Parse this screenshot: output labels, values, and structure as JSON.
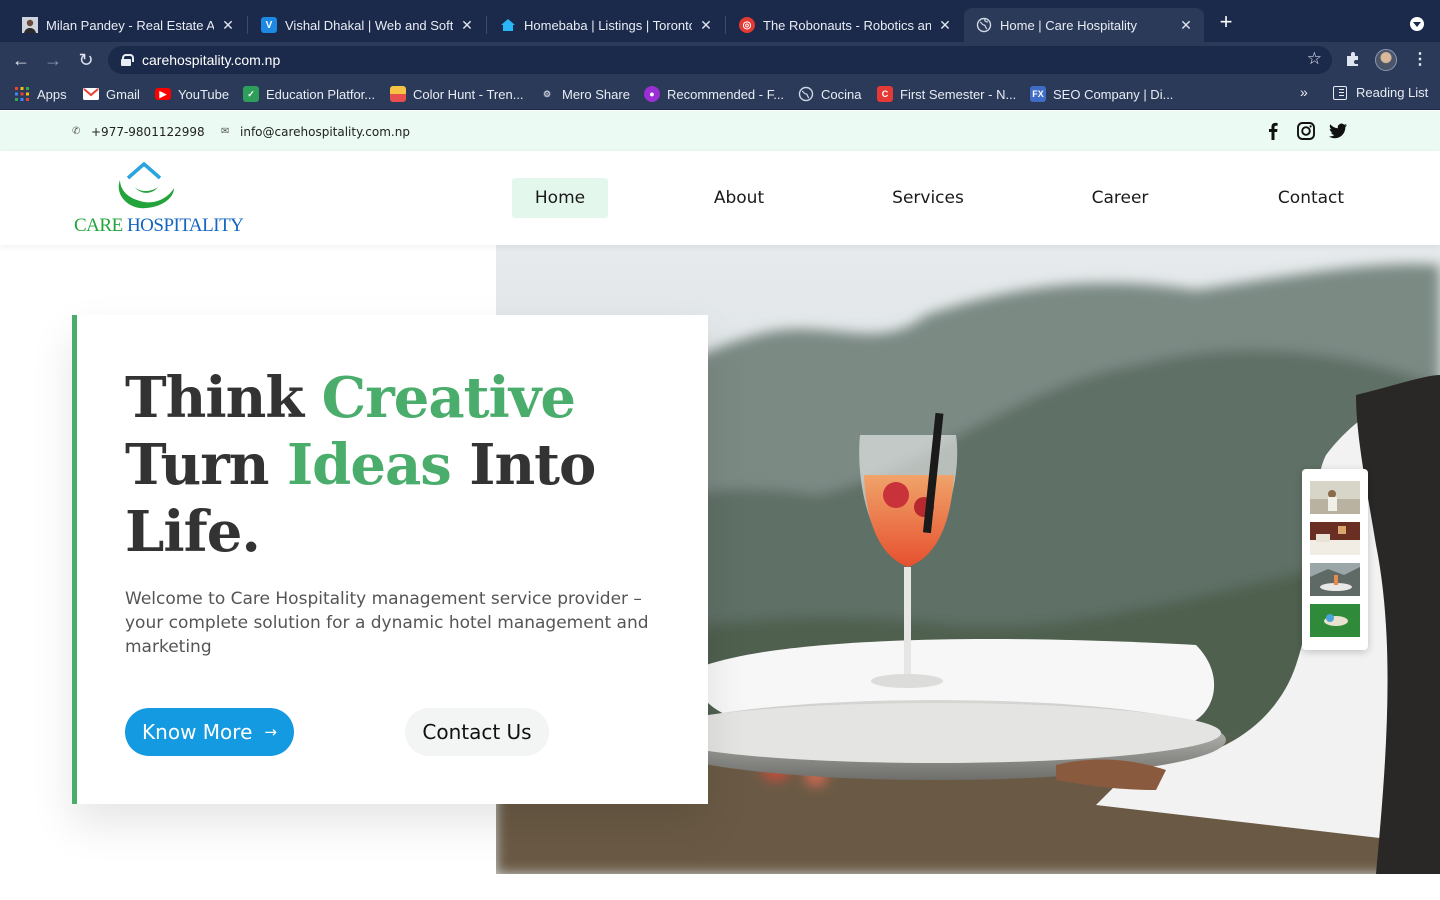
{
  "browser": {
    "tabs": [
      {
        "title": "Milan Pandey - Real Estate Agent",
        "favicon": "person-photo-icon",
        "active": false
      },
      {
        "title": "Vishal Dhakal | Web and Software",
        "favicon": "v-logo-icon",
        "active": false
      },
      {
        "title": "Homebaba | Listings | Toronto",
        "favicon": "house-icon",
        "active": false
      },
      {
        "title": "The Robonauts - Robotics and",
        "favicon": "robonauts-icon",
        "active": false
      },
      {
        "title": "Home | Care Hospitality",
        "favicon": "globe-icon",
        "active": true
      }
    ],
    "url": "carehospitality.com.np",
    "bookmarks": [
      {
        "label": "Apps",
        "icon": "apps-grid-icon",
        "color": "#f4b400"
      },
      {
        "label": "Gmail",
        "icon": "gmail-icon",
        "color": "#ea4335"
      },
      {
        "label": "YouTube",
        "icon": "youtube-icon",
        "color": "#ff0000"
      },
      {
        "label": "Education Platfor...",
        "icon": "education-icon",
        "color": "#2e9e5b"
      },
      {
        "label": "Color Hunt - Tren...",
        "icon": "colorhunt-icon",
        "color": "#f6c342"
      },
      {
        "label": "Mero Share",
        "icon": "meroshare-icon",
        "color": "#8a8fa3"
      },
      {
        "label": "Recommended - F...",
        "icon": "recommended-icon",
        "color": "#9b2fd4"
      },
      {
        "label": "Cocina",
        "icon": "globe-icon",
        "color": "#8a8fa3"
      },
      {
        "label": "First Semester - N...",
        "icon": "c-logo-icon",
        "color": "#e53935"
      },
      {
        "label": "SEO Company | Di...",
        "icon": "fx-logo-icon",
        "color": "#3f6cc7"
      }
    ],
    "reading_list": "Reading List"
  },
  "site": {
    "phone": "+977-9801122998",
    "email": "info@carehospitality.com.np",
    "logo": {
      "part1": "CARE ",
      "part2": "HOSPITALITY"
    },
    "nav": [
      {
        "label": "Home",
        "active": true
      },
      {
        "label": "About",
        "active": false
      },
      {
        "label": "Services",
        "active": false
      },
      {
        "label": "Career",
        "active": false
      },
      {
        "label": "Contact",
        "active": false
      }
    ],
    "hero": {
      "line1_a": "Think ",
      "line1_b": "Creative",
      "line2_a": "Turn ",
      "line2_b": "Ideas",
      "line2_c": " Into",
      "line3": "Life.",
      "description": "Welcome to Care Hospitality management service provider – your complete solution for a dynamic hotel management and marketing",
      "know_more": "Know More",
      "contact_us": "Contact Us"
    },
    "colors": {
      "accent_green": "#4aad6c",
      "button_blue": "#139ae0",
      "strip_bg": "#ebfaf2"
    }
  }
}
